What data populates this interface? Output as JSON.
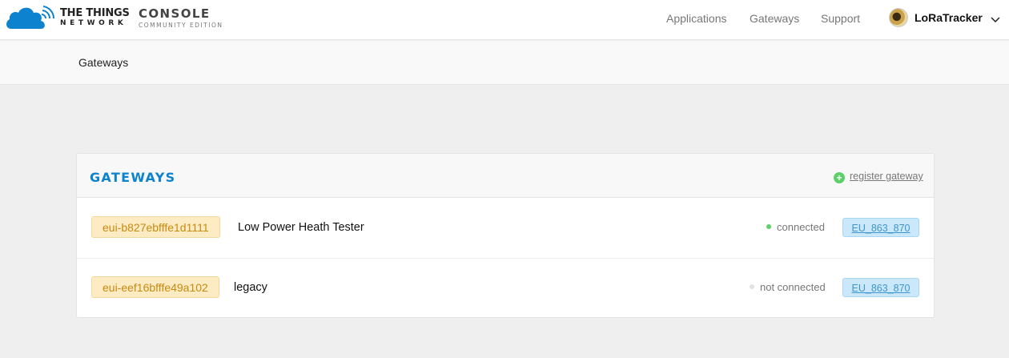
{
  "header": {
    "brand_line1": "THE THINGS",
    "brand_line2": "NETWORK",
    "console_title": "CONSOLE",
    "console_subtitle": "COMMUNITY EDITION",
    "nav": [
      "Applications",
      "Gateways",
      "Support"
    ],
    "username": "LoRaTracker"
  },
  "breadcrumb": {
    "current": "Gateways"
  },
  "panel": {
    "title": "GATEWAYS",
    "register_label": "register gateway",
    "rows": [
      {
        "eui": "eui-b827ebfffe1d1111",
        "name": "Low Power Heath Tester",
        "status": "connected",
        "status_color": "#5ed06a",
        "frequency_plan": "EU_863_870"
      },
      {
        "eui": "eui-eef16bfffe49a102",
        "name": "legacy",
        "status": "not connected",
        "status_color": "#e2e2e2",
        "frequency_plan": "EU_863_870"
      }
    ]
  },
  "colors": {
    "accent": "#0d83d0",
    "eui_text": "#c98a10",
    "eui_bg": "#fdebc4",
    "freq_bg": "#cbe8fb"
  },
  "icons": {
    "logo": "ttn-cloud-logo",
    "register": "plus-circle-icon",
    "menu": "chevron-down-icon"
  }
}
